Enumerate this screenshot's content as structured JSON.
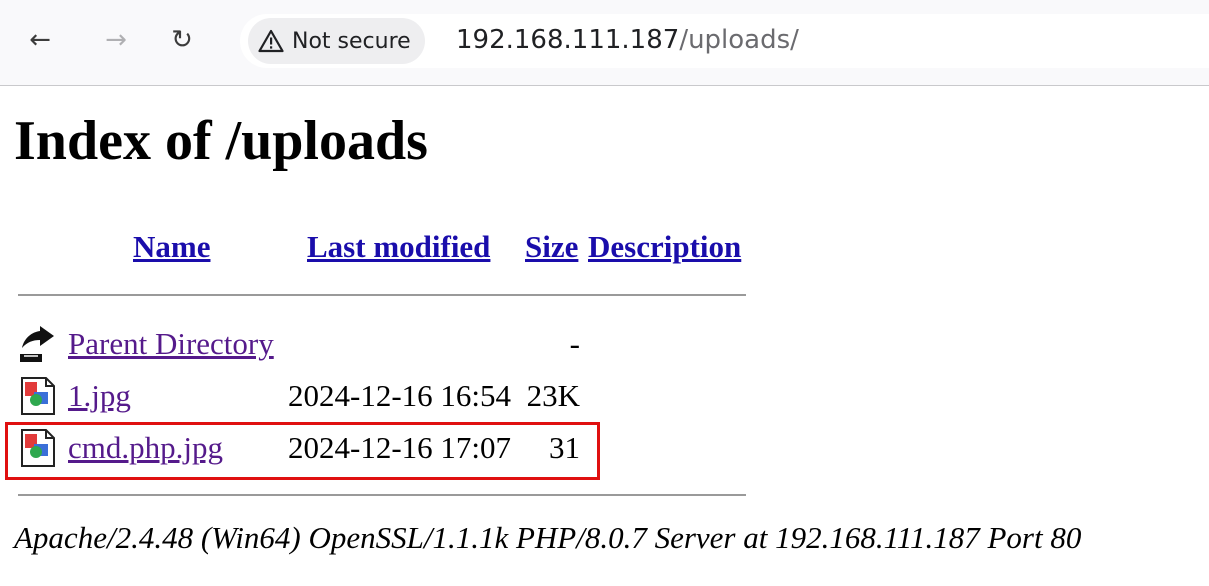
{
  "browser": {
    "security_label": "Not secure",
    "url_host": "192.168.111.187",
    "url_path": "/uploads/"
  },
  "page": {
    "title": "Index of /uploads",
    "columns": {
      "name": "Name",
      "last_modified": "Last modified",
      "size": "Size",
      "description": "Description"
    },
    "parent": {
      "name": "Parent Directory",
      "size": "-"
    },
    "files": [
      {
        "name": "1.jpg",
        "modified": "2024-12-16 16:54",
        "size": "23K",
        "icon": "image-file-icon"
      },
      {
        "name": "cmd.php.jpg",
        "modified": "2024-12-16 17:07",
        "size": "31",
        "icon": "image-file-icon"
      }
    ],
    "server_signature": "Apache/2.4.48 (Win64) OpenSSL/1.1.1k PHP/8.0.7 Server at 192.168.111.187 Port 80"
  },
  "colors": {
    "link": "#1a0dab",
    "visited_link": "#551a8b",
    "highlight_box": "#e01010"
  }
}
